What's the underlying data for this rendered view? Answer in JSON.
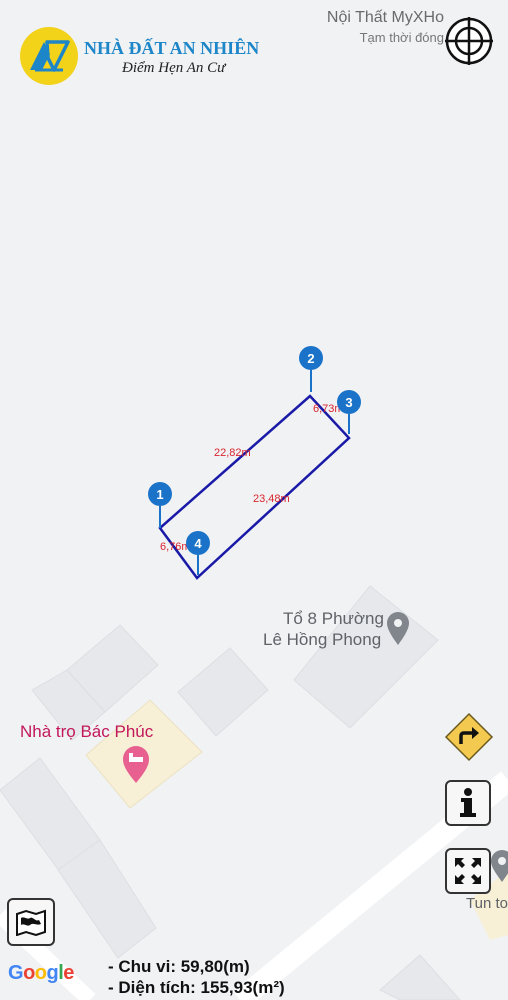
{
  "brand": {
    "title": "NHÀ ĐẤT AN NHIÊN",
    "slogan": "Điểm Hẹn An Cư",
    "primary_color": "#1d86c8",
    "accent_color": "#f3d21a"
  },
  "poi_top": {
    "name": "Nội Thất MyXHo",
    "status": "Tạm thời đóng"
  },
  "places": {
    "ward_line1": "Tổ 8 Phường",
    "ward_line2": "Lê Hồng Phong",
    "hotel": "Nhà trọ Bác Phúc",
    "partial": "Tun to"
  },
  "plot": {
    "line_color": "#1a1aa8",
    "pins": [
      "1",
      "2",
      "3",
      "4"
    ],
    "edges": [
      "22,82m",
      "6,73m",
      "23,48m",
      "6,76m"
    ]
  },
  "icons": {
    "locate": "crosshair-icon",
    "direction": "turn-right-icon",
    "info": "info-icon",
    "fullscreen": "expand-icon",
    "map_layer": "map-icon",
    "place_marker": "place-pin-icon",
    "hotel_marker": "bed-icon"
  },
  "google": "Google",
  "measurements": {
    "perimeter": "- Chu vi: 59,80(m)",
    "area": "- Diện tích: 155,93(m²)"
  }
}
